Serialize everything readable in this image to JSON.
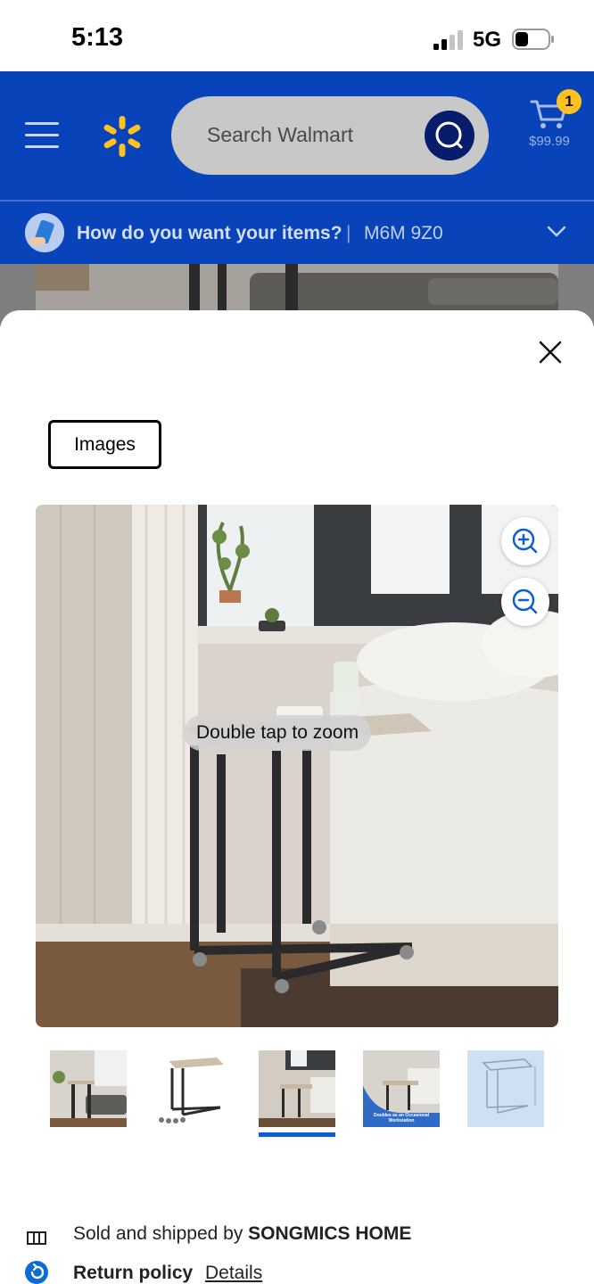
{
  "status_bar": {
    "time": "5:13",
    "network": "5G"
  },
  "header": {
    "search_placeholder": "Search Walmart",
    "cart_count": "1",
    "cart_total": "$99.99"
  },
  "delivery": {
    "question": "How do you want your items?",
    "separator": "|",
    "postal_code": "M6M 9Z0"
  },
  "modal": {
    "tab_label": "Images",
    "zoom_hint": "Double tap to zoom",
    "active_thumbnail_index": 2,
    "thumbnails": [
      {
        "caption": ""
      },
      {
        "caption": ""
      },
      {
        "caption": ""
      },
      {
        "caption": "Doubles as an Occasional Workstation"
      },
      {
        "caption": ""
      }
    ]
  },
  "page_below": {
    "sold_by_prefix": "Sold and shipped by",
    "seller": "SONGMICS HOME",
    "return_label": "Return policy",
    "return_link": "Details"
  },
  "colors": {
    "brand_blue": "#0843b9",
    "spark_yellow": "#ffc220",
    "active_indicator": "#0b5ed7"
  }
}
